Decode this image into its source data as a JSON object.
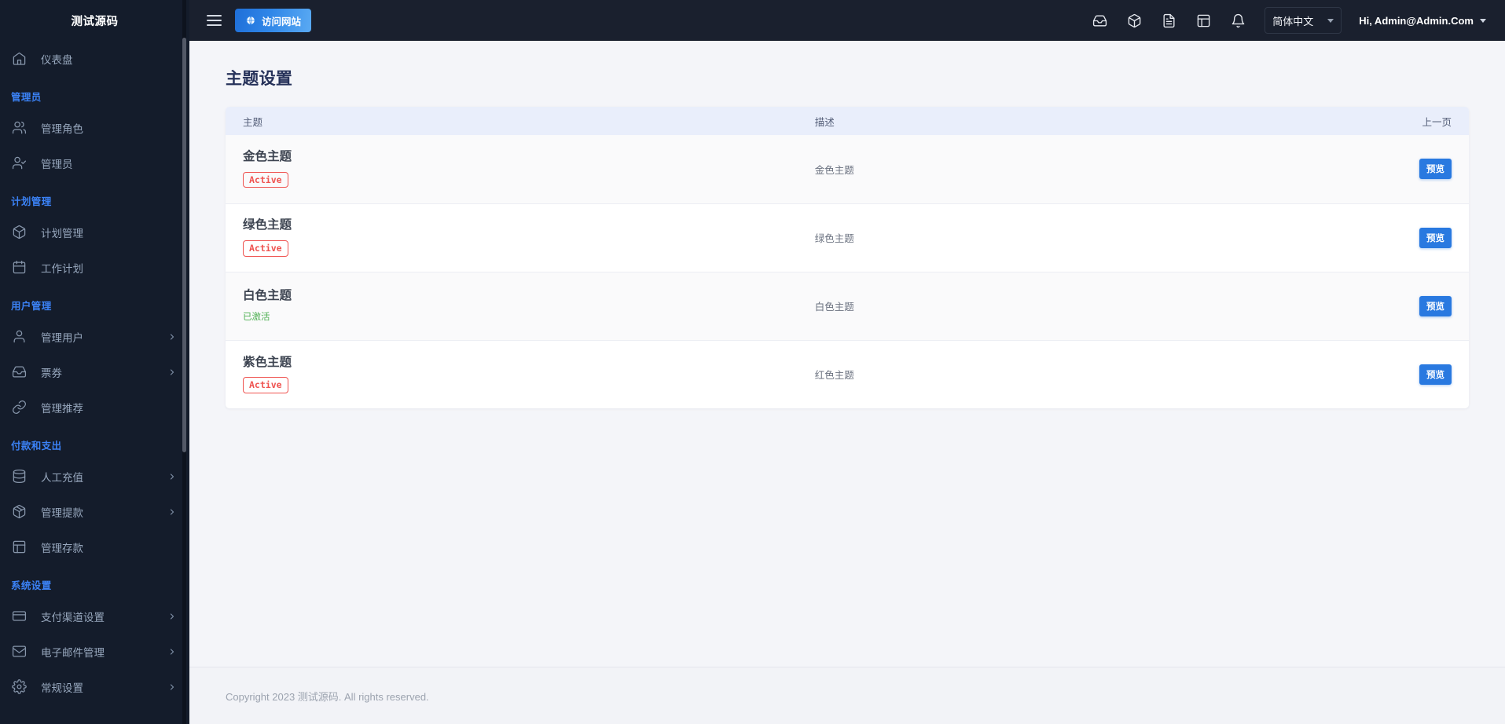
{
  "sidebar": {
    "brand": "测试源码",
    "groups": [
      {
        "title": null,
        "items": [
          {
            "label": "仪表盘",
            "icon": "home-icon",
            "chevron": false
          }
        ]
      },
      {
        "title": "管理员",
        "items": [
          {
            "label": "管理角色",
            "icon": "users-icon",
            "chevron": false
          },
          {
            "label": "管理员",
            "icon": "user-check-icon",
            "chevron": false
          }
        ]
      },
      {
        "title": "计划管理",
        "items": [
          {
            "label": "计划管理",
            "icon": "box-icon",
            "chevron": false
          },
          {
            "label": "工作计划",
            "icon": "calendar-icon",
            "chevron": false
          }
        ]
      },
      {
        "title": "用户管理",
        "items": [
          {
            "label": "管理用户",
            "icon": "user-icon",
            "chevron": true
          },
          {
            "label": "票券",
            "icon": "inbox-icon",
            "chevron": true
          },
          {
            "label": "管理推荐",
            "icon": "link-icon",
            "chevron": false
          }
        ]
      },
      {
        "title": "付款和支出",
        "items": [
          {
            "label": "人工充值",
            "icon": "database-icon",
            "chevron": true
          },
          {
            "label": "管理提款",
            "icon": "package-icon",
            "chevron": true
          },
          {
            "label": "管理存款",
            "icon": "layout-icon",
            "chevron": false
          }
        ]
      },
      {
        "title": "系统设置",
        "items": [
          {
            "label": "支付渠道设置",
            "icon": "credit-card-icon",
            "chevron": true
          },
          {
            "label": "电子邮件管理",
            "icon": "mail-icon",
            "chevron": true
          },
          {
            "label": "常规设置",
            "icon": "gear-icon",
            "chevron": true
          }
        ]
      }
    ]
  },
  "topbar": {
    "menu_toggle": "menu-icon",
    "visit_site_label": "访问网站",
    "icons": [
      {
        "name": "inbox-icon"
      },
      {
        "name": "package-icon"
      },
      {
        "name": "file-text-icon"
      },
      {
        "name": "table-icon"
      },
      {
        "name": "bell-icon"
      }
    ],
    "language": {
      "selected": "简体中文",
      "options": [
        "简体中文"
      ]
    },
    "user_greeting": "Hi, Admin@Admin.Com"
  },
  "page": {
    "title": "主题设置"
  },
  "table": {
    "columns": [
      "主题",
      "描述",
      "上一页"
    ],
    "rows": [
      {
        "name": "金色主题",
        "status_label": "Active",
        "status_type": "badge",
        "description": "金色主题",
        "action": "预览"
      },
      {
        "name": "绿色主题",
        "status_label": "Active",
        "status_type": "badge",
        "description": "绿色主题",
        "action": "预览"
      },
      {
        "name": "白色主题",
        "status_label": "已激活",
        "status_type": "text",
        "description": "白色主题",
        "action": "预览"
      },
      {
        "name": "紫色主题",
        "status_label": "Active",
        "status_type": "badge",
        "description": "红色主题",
        "action": "预览"
      }
    ]
  },
  "footer": {
    "copyright": "Copyright 2023 测试源码. All rights reserved."
  },
  "colors": {
    "sidebar_bg": "#141c2b",
    "topbar_bg": "#1a202e",
    "accent_blue": "#2979e0",
    "section_title": "#3b82f6",
    "badge_red": "#ef5350",
    "activated_green": "#4caf50",
    "table_header_bg": "#e9eefb",
    "page_title": "#26325a"
  }
}
